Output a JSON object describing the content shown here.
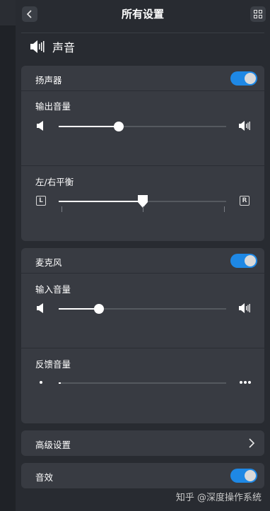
{
  "header": {
    "title": "所有设置",
    "back_icon": "chevron-left-icon",
    "grid_icon": "grid-icon"
  },
  "section": {
    "title": "声音",
    "icon": "speaker-icon"
  },
  "speaker": {
    "label": "扬声器",
    "enabled": true,
    "output_volume": {
      "label": "输出音量",
      "value": 0.36
    },
    "balance": {
      "label": "左/右平衡",
      "left_label": "L",
      "right_label": "R",
      "value": 0.5
    }
  },
  "microphone": {
    "label": "麦克风",
    "enabled": true,
    "input_volume": {
      "label": "输入音量",
      "value": 0.24
    },
    "feedback": {
      "label": "反馈音量",
      "value": 0.01
    }
  },
  "advanced": {
    "label": "高级设置"
  },
  "effects": {
    "label": "音效",
    "enabled": true
  },
  "watermark": "知乎 @深度操作系统",
  "colors": {
    "accent": "#1e88e5",
    "panel": "#282b31",
    "card": "#383b42"
  }
}
